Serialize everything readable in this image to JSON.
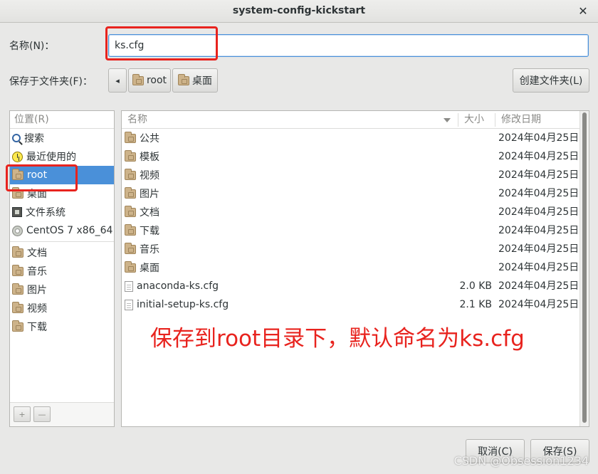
{
  "window": {
    "title": "system-config-kickstart",
    "close_glyph": "✕"
  },
  "name_row": {
    "label": "名称(N)：",
    "value": "ks.cfg"
  },
  "folder_row": {
    "label": "保存于文件夹(F)：",
    "back_glyph": "◂",
    "path": [
      "root",
      "桌面"
    ],
    "create_folder_label": "创建文件夹(L)"
  },
  "sidebar": {
    "header": "位置(R)",
    "items": [
      {
        "label": "搜索",
        "icon": "search-icon"
      },
      {
        "label": "最近使用的",
        "icon": "recent-icon"
      },
      {
        "label": "root",
        "icon": "home-folder-icon",
        "selected": true
      },
      {
        "label": "桌面",
        "icon": "desktop-folder-icon"
      },
      {
        "label": "文件系统",
        "icon": "drive-icon"
      },
      {
        "label": "CentOS 7 x86_64",
        "icon": "disc-icon"
      }
    ],
    "bookmarks": [
      {
        "label": "文档",
        "icon": "folder-icon"
      },
      {
        "label": "音乐",
        "icon": "folder-icon"
      },
      {
        "label": "图片",
        "icon": "folder-icon"
      },
      {
        "label": "视频",
        "icon": "folder-icon"
      },
      {
        "label": "下载",
        "icon": "folder-icon"
      }
    ],
    "add_glyph": "+",
    "remove_glyph": "—"
  },
  "file_list": {
    "columns": {
      "name": "名称",
      "size": "大小",
      "modified": "修改日期"
    },
    "rows": [
      {
        "name": "公共",
        "size": "",
        "modified": "2024年04月25日",
        "type": "folder"
      },
      {
        "name": "模板",
        "size": "",
        "modified": "2024年04月25日",
        "type": "folder"
      },
      {
        "name": "视频",
        "size": "",
        "modified": "2024年04月25日",
        "type": "folder"
      },
      {
        "name": "图片",
        "size": "",
        "modified": "2024年04月25日",
        "type": "folder"
      },
      {
        "name": "文档",
        "size": "",
        "modified": "2024年04月25日",
        "type": "folder"
      },
      {
        "name": "下载",
        "size": "",
        "modified": "2024年04月25日",
        "type": "folder"
      },
      {
        "name": "音乐",
        "size": "",
        "modified": "2024年04月25日",
        "type": "folder"
      },
      {
        "name": "桌面",
        "size": "",
        "modified": "2024年04月25日",
        "type": "folder"
      },
      {
        "name": "anaconda-ks.cfg",
        "size": "2.0 KB",
        "modified": "2024年04月25日",
        "type": "file"
      },
      {
        "name": "initial-setup-ks.cfg",
        "size": "2.1 KB",
        "modified": "2024年04月25日",
        "type": "file"
      }
    ]
  },
  "annotation": "保存到root目录下，默认命名为ks.cfg",
  "buttons": {
    "cancel": "取消(C)",
    "save": "保存(S)"
  },
  "watermark": "CSDN @Obsession1234",
  "colors": {
    "selection": "#4a90d9",
    "annotation_red": "#e8231e"
  }
}
